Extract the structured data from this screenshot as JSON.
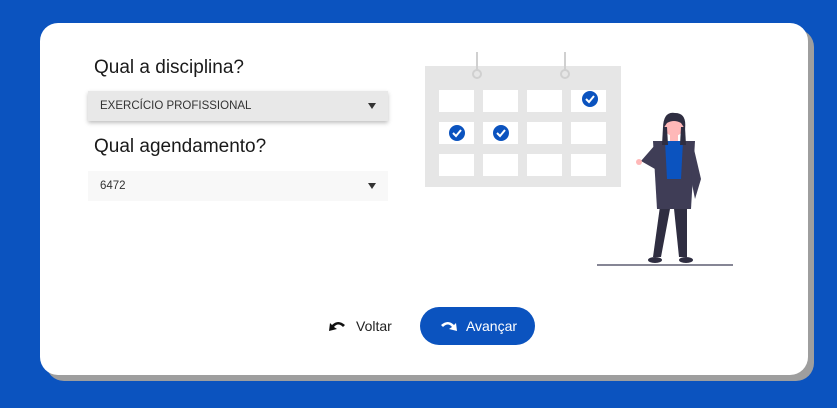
{
  "form": {
    "discipline_question": "Qual a disciplina?",
    "discipline_value": "EXERCÍCIO PROFISSIONAL",
    "schedule_question": "Qual agendamento?",
    "schedule_value": "6472"
  },
  "actions": {
    "back_label": "Voltar",
    "next_label": "Avançar"
  },
  "icons": {
    "back": "undo-arrow-icon",
    "next": "redo-arrow-icon",
    "select_caret": "caret-down-icon"
  },
  "colors": {
    "background": "#0b53bf",
    "accent": "#0b53bf",
    "card": "#ffffff"
  }
}
